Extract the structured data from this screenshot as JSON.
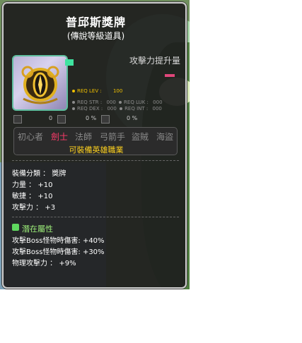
{
  "item": {
    "name": "普邱斯獎牌",
    "grade": "(傳說等級道具)"
  },
  "attack_increase": {
    "label": "攻擊力提升量"
  },
  "requirements": {
    "req_lev": "REQ LEV :",
    "req_lev_val": "100",
    "req_str": "REQ STR :",
    "req_str_val": "000",
    "req_luk": "REQ LUK :",
    "req_luk_val": "000",
    "req_dex": "REQ DEX :",
    "req_dex_val": "000",
    "req_int": "REQ INT :",
    "req_int_val": "000"
  },
  "mini_stats": [
    {
      "icon": "sword-icon",
      "value": "0"
    },
    {
      "icon": "crown-icon",
      "value": "0 %"
    },
    {
      "icon": "shield-icon",
      "value": "0 %"
    }
  ],
  "jobs": {
    "items": [
      "初心者",
      "劍士",
      "法師",
      "弓箭手",
      "盜賊",
      "海盜"
    ],
    "active": "劍士",
    "hero_note": "可裝備英雄職業"
  },
  "stats": {
    "category": "裝備分類 ： 獎牌",
    "str": "力量 ： +10",
    "dex": "敏捷 ： +10",
    "atk": "攻擊力 ： +3"
  },
  "potential": {
    "label": "潛在屬性",
    "lines": [
      "攻擊Boss怪物時傷害: +40%",
      "攻擊Boss怪物時傷害: +30%",
      "物理攻擊力 ： +9%"
    ]
  },
  "colors": {
    "title": "#ffffff",
    "req_active": "#f0c000",
    "job_active": "#ff3b6b",
    "hero": "#ffd21e",
    "potential": "#9ef07a"
  }
}
